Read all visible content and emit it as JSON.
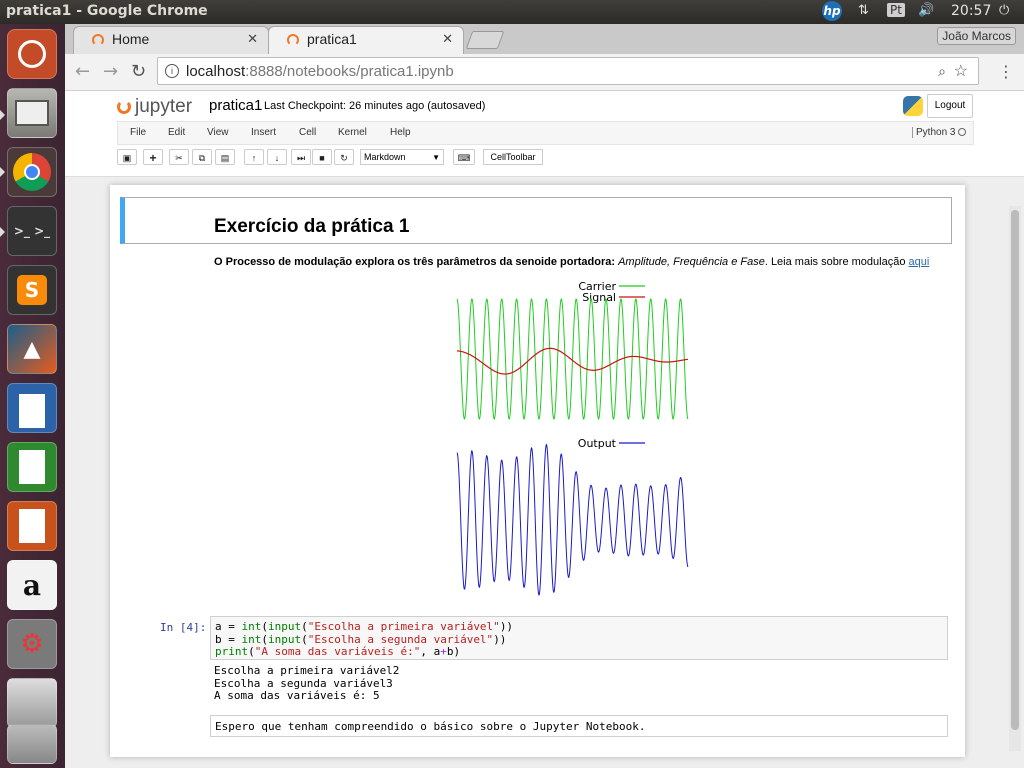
{
  "system": {
    "window_title": "pratica1 - Google Chrome",
    "keyboard_layout": "Pt",
    "time": "20:57",
    "indicators": [
      "hp-icon",
      "keyboard-icon",
      "volume-icon",
      "power-icon"
    ]
  },
  "launcher": {
    "items": [
      "ubuntu-dash",
      "files",
      "chrome",
      "terminal",
      "sublime-text",
      "matlab",
      "libreoffice-writer",
      "libreoffice-calc",
      "libreoffice-impress",
      "amazon",
      "system-settings",
      "disk",
      "trash"
    ]
  },
  "browser": {
    "tabs": [
      {
        "label": "Home",
        "active": false
      },
      {
        "label": "pratica1",
        "active": true
      }
    ],
    "profile": "João Marcos",
    "url_host": "localhost",
    "url_rest": ":8888/notebooks/pratica1.ipynb"
  },
  "jupyter": {
    "logo": "jupyter",
    "notebook_name": "pratica1",
    "checkpoint": "Last Checkpoint: 26 minutes ago (autosaved)",
    "logout": "Logout",
    "menu": [
      "File",
      "Edit",
      "View",
      "Insert",
      "Cell",
      "Kernel",
      "Help"
    ],
    "kernel": "Python 3",
    "cell_type": "Markdown",
    "cell_toolbar": "CellToolbar"
  },
  "notebook": {
    "heading": "Exercício da prática 1",
    "intro_bold": "O Processo de modulação explora os três parâmetros da senoide portadora:",
    "intro_italic": "Amplitude, Frequência e Fase",
    "intro_rest": ". Leia mais sobre modulação ",
    "intro_link": "aqui",
    "figure": {
      "legend_carrier": "Carrier",
      "legend_signal": "Signal",
      "legend_output": "Output",
      "colors": {
        "carrier": "#22cc22",
        "signal": "#cc1111",
        "output": "#1a1acc"
      }
    },
    "code_prompt": "In [4]:",
    "code_line1_a": "a = ",
    "code_line1_b": "int",
    "code_line1_c": "(",
    "code_line1_d": "input",
    "code_line1_e": "(",
    "code_line1_f": "\"Escolha a primeira variável\"",
    "code_line1_g": "))",
    "code_line2_a": "b = ",
    "code_line2_b": "int",
    "code_line2_c": "(",
    "code_line2_d": "input",
    "code_line2_e": "(",
    "code_line2_f": "\"Escolha a segunda variável\"",
    "code_line2_g": "))",
    "code_line3_a": "print",
    "code_line3_b": "(",
    "code_line3_c": "\"A soma das variáveis é:\"",
    "code_line3_d": ", a",
    "code_line3_e": "+",
    "code_line3_f": "b",
    "code_line3_g": ")",
    "output_lines": [
      "Escolha a primeira variável2",
      "Escolha a segunda variável3",
      "A soma das variáveis é: 5"
    ],
    "raw_text": "Espero que tenham compreendido o básico sobre o Jupyter Notebook."
  }
}
